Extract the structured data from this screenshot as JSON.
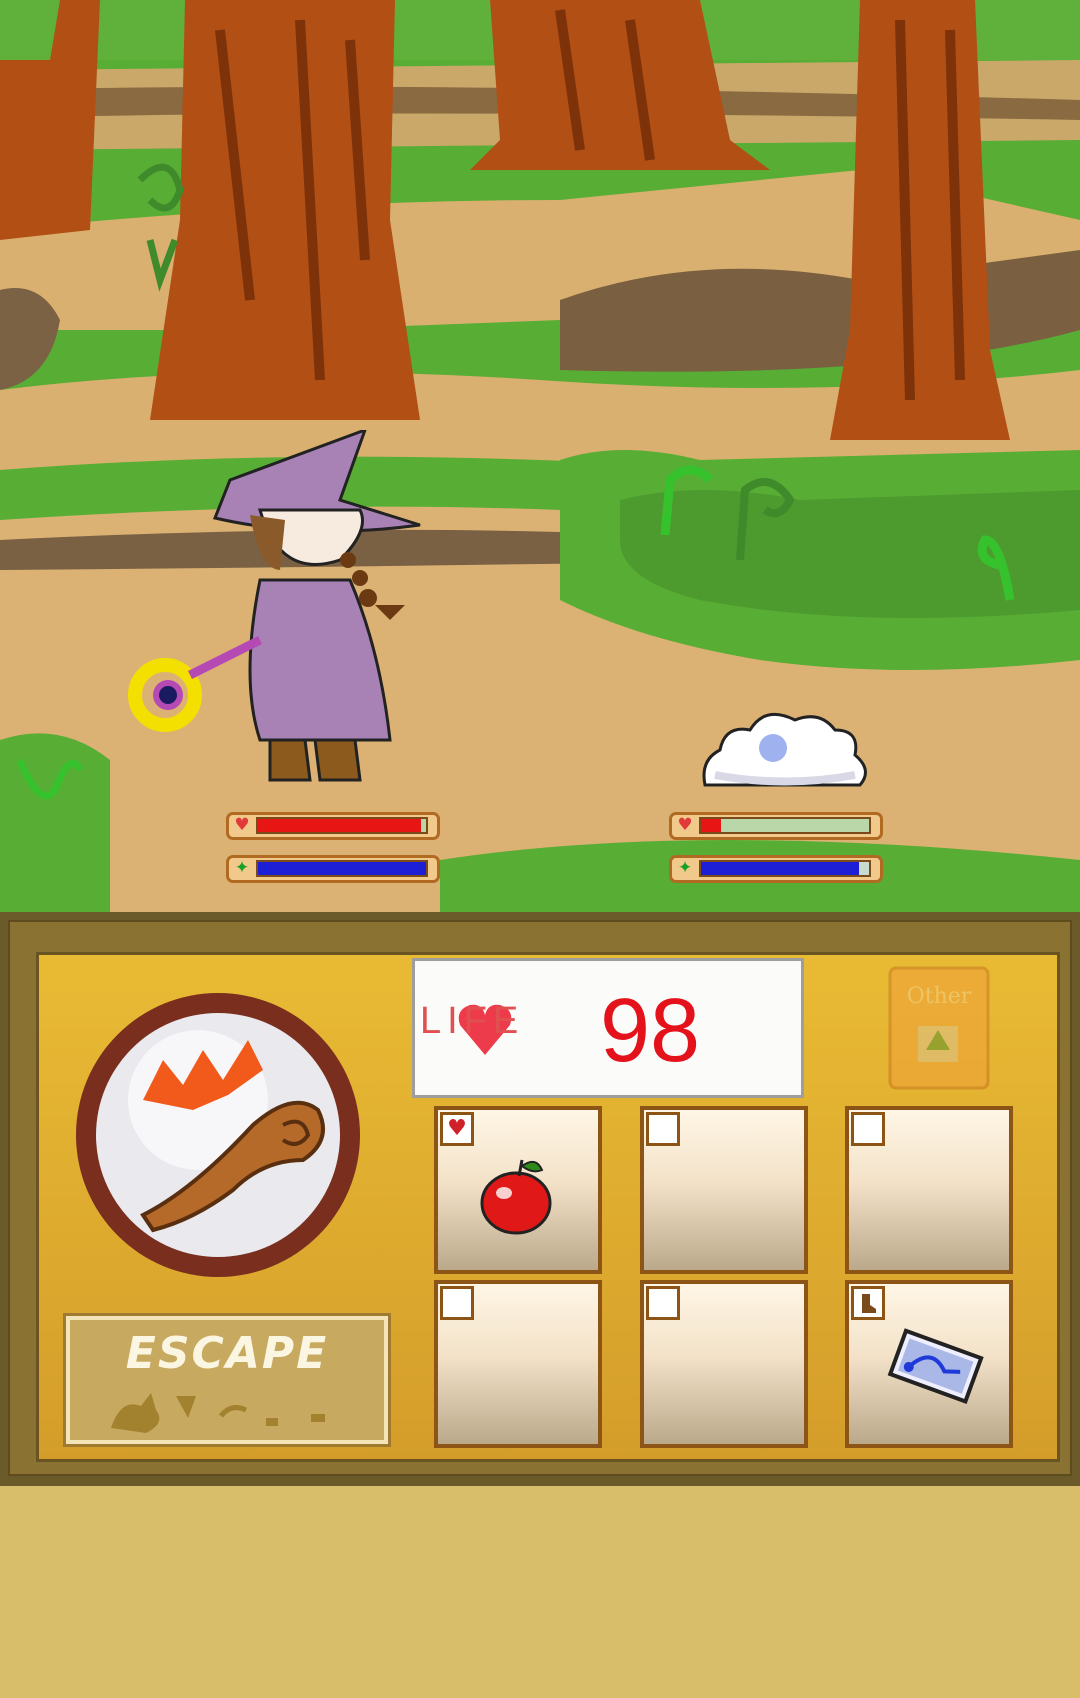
{
  "hud": {
    "player": {
      "hp": 0.97,
      "mp": 1.0
    },
    "enemy": {
      "hp": 0.12,
      "mp": 0.94
    },
    "colors": {
      "hp": "#e81515",
      "hp_empty": "#b9d7a8",
      "mp": "#1d1fd6",
      "mp_empty": "#c7dccf"
    }
  },
  "life": {
    "label": "LIFE",
    "value": "98"
  },
  "actions": {
    "attack_icon": "staff-attack-icon",
    "escape_label": "ESCAPE"
  },
  "other_book": {
    "label": "Other"
  },
  "inventory": [
    {
      "tag": "heart-icon",
      "item": "apple-icon"
    },
    {
      "tag": "empty",
      "item": ""
    },
    {
      "tag": "empty",
      "item": ""
    },
    {
      "tag": "empty",
      "item": ""
    },
    {
      "tag": "empty",
      "item": ""
    },
    {
      "tag": "boot-icon",
      "item": "magic-card-icon"
    }
  ]
}
